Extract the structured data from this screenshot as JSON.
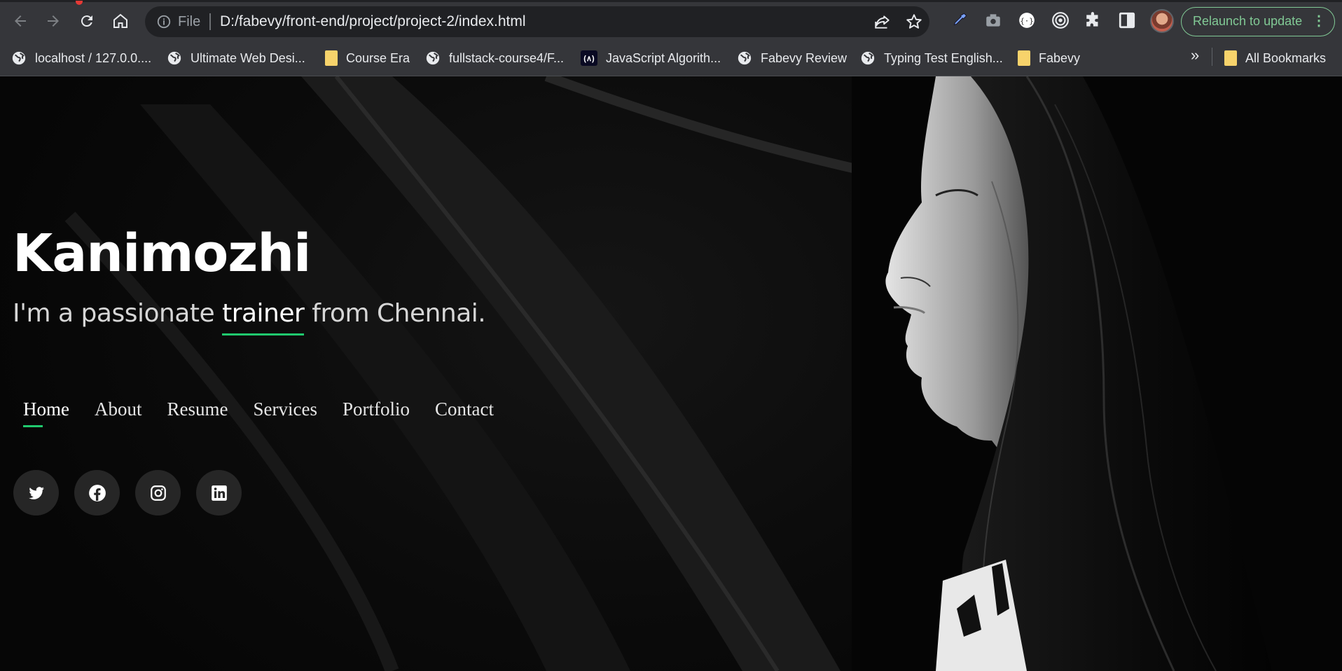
{
  "browser": {
    "address": {
      "scheme": "File",
      "url": "D:/fabevy/front-end/project/project-2/index.html"
    },
    "relaunch_label": "Relaunch to update",
    "accent_color": "#81c995",
    "bookmarks": [
      {
        "label": "localhost / 127.0.0....",
        "icon": "globe-icon"
      },
      {
        "label": "Ultimate Web Desi...",
        "icon": "globe-icon"
      },
      {
        "label": "Course Era",
        "icon": "folder-icon"
      },
      {
        "label": "fullstack-course4/F...",
        "icon": "globe-icon"
      },
      {
        "label": "JavaScript Algorith...",
        "icon": "freecodecamp-icon"
      },
      {
        "label": "Fabevy Review",
        "icon": "globe-icon"
      },
      {
        "label": "Typing Test English...",
        "icon": "globe-icon"
      },
      {
        "label": "Fabevy",
        "icon": "folder-icon"
      }
    ],
    "overflow_label": "»",
    "all_bookmarks_label": "All Bookmarks"
  },
  "hero": {
    "name": "Kanimozhi",
    "tagline_before": "I'm a passionate ",
    "tagline_typed": "trainer",
    "tagline_after": " from Chennai.",
    "accent_color": "#20c96e"
  },
  "nav": {
    "items": [
      "Home",
      "About",
      "Resume",
      "Services",
      "Portfolio",
      "Contact"
    ],
    "active": "Home"
  },
  "social": [
    "twitter-icon",
    "facebook-icon",
    "instagram-icon",
    "linkedin-icon"
  ]
}
